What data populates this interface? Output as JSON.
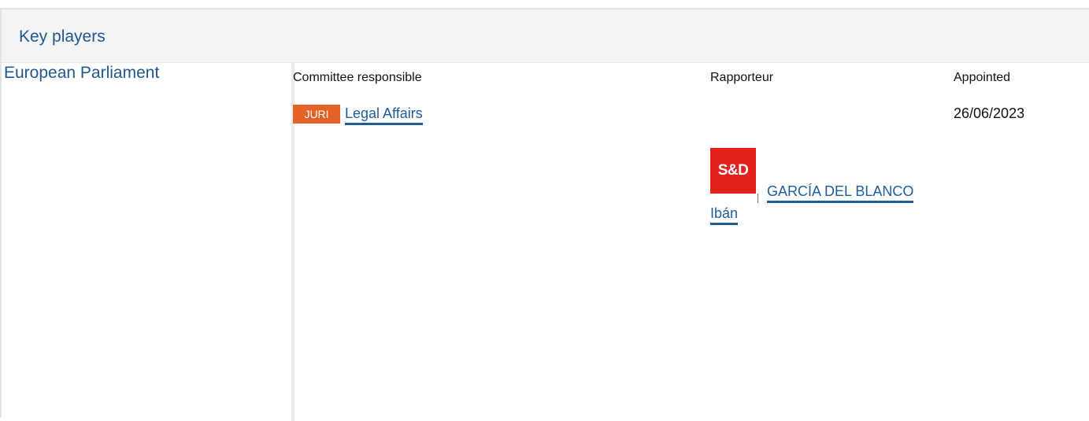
{
  "panel": {
    "title": "Key players"
  },
  "institution": {
    "name": "European Parliament"
  },
  "columns": {
    "committee": "Committee responsible",
    "rapporteur": "Rapporteur",
    "appointed": "Appointed"
  },
  "committee": {
    "code": "JURI",
    "name": "Legal Affairs",
    "appointed": "26/06/2023",
    "badge_color": "#e26227"
  },
  "rapporteur": {
    "group_logo_text": "S&D",
    "group_color": "#e2211c",
    "name_line1": "GARCÍA DEL BLANCO",
    "name_line2": "Ibán"
  },
  "colors": {
    "accent": "#205890",
    "link": "#1f5c9a"
  }
}
